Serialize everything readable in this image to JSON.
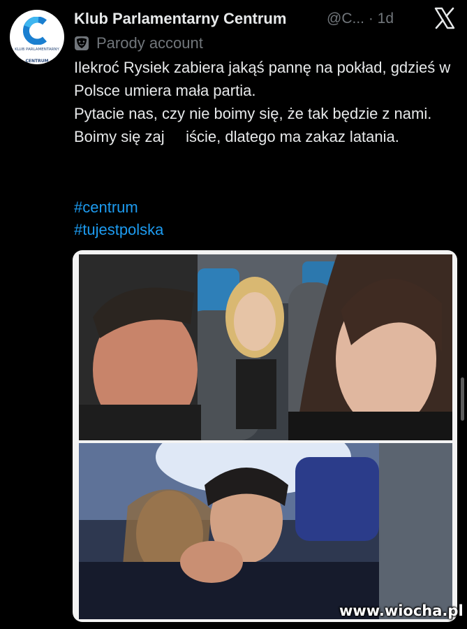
{
  "author": {
    "name": "Klub Parlamentarny Centrum",
    "handle": "@C...",
    "time": "· 1d",
    "label": "Parody account",
    "avatar_text_small": "KLUB PARLAMENTARNY",
    "avatar_text_big": "CENTRUM"
  },
  "tweet": {
    "lines": [
      "Ilekroć Rysiek zabiera jakąś pannę na pokład, gdzieś w Polsce umiera mała partia.",
      "Pytacie nas, czy nie boimy się, że tak będzie z nami.",
      "Boimy się zaj     iście, dlatego ma zakaz latania."
    ],
    "hashtags": [
      "#centrum",
      "#tujestpolska"
    ]
  },
  "watermark": "www.wiocha.pl",
  "colors": {
    "background": "#000000",
    "text": "#e7e9ea",
    "secondary": "#71767b",
    "link": "#1d9bf0",
    "brand": "#1a7fd0"
  },
  "icons": [
    "x-logo-icon",
    "parody-mask-icon",
    "centrum-logo-icon"
  ]
}
